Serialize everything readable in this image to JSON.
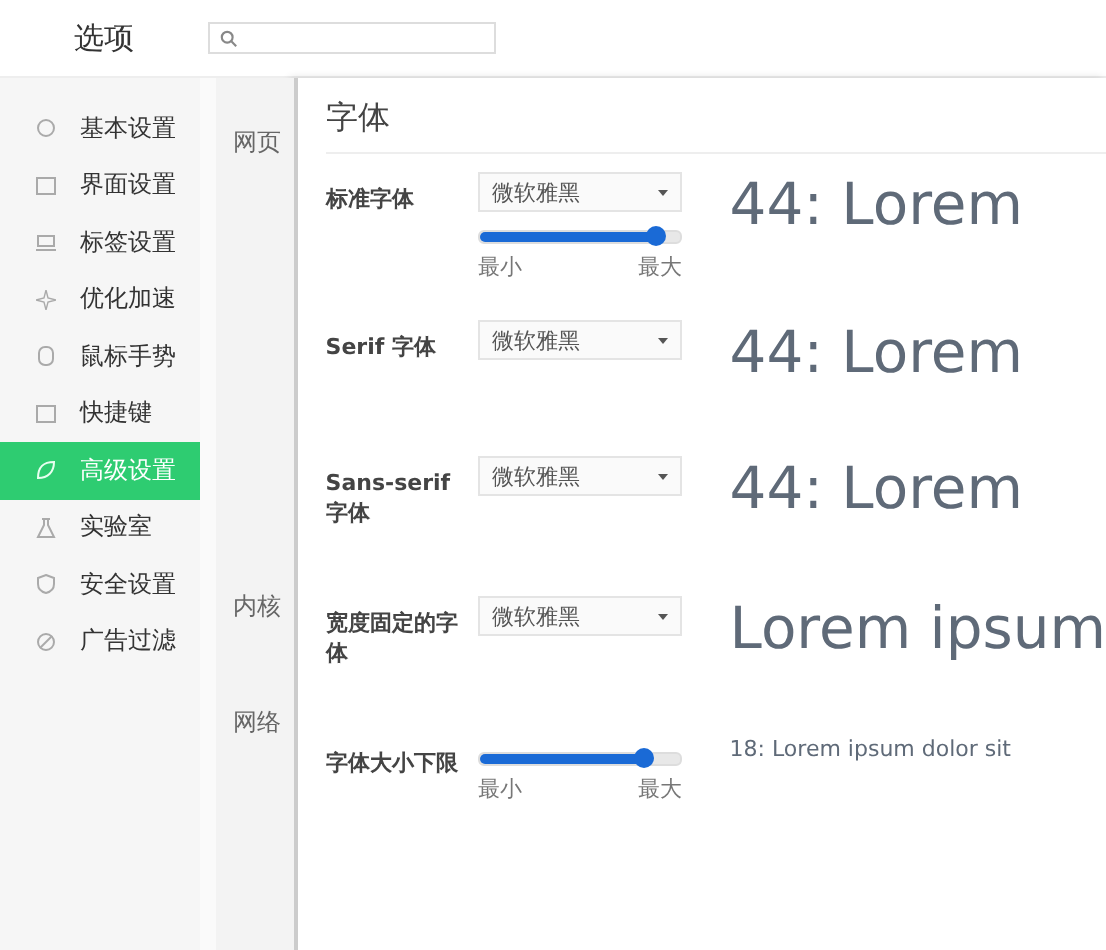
{
  "header": {
    "title": "选项"
  },
  "sidebar": {
    "items": [
      {
        "label": "基本设置",
        "selected": false
      },
      {
        "label": "界面设置",
        "selected": false
      },
      {
        "label": "标签设置",
        "selected": false
      },
      {
        "label": "优化加速",
        "selected": false
      },
      {
        "label": "鼠标手势",
        "selected": false
      },
      {
        "label": "快捷键",
        "selected": false
      },
      {
        "label": "高级设置",
        "selected": true
      },
      {
        "label": "实验室",
        "selected": false
      },
      {
        "label": "安全设置",
        "selected": false
      },
      {
        "label": "广告过滤",
        "selected": false
      }
    ]
  },
  "background_sections": [
    "网页",
    "内核",
    "网络"
  ],
  "dialog": {
    "title": "字体",
    "rows": [
      {
        "label": "标准字体",
        "select": "微软雅黑",
        "slider": {
          "level": 0.88,
          "min_label": "最小",
          "max_label": "最大"
        },
        "sample": {
          "kind": "large",
          "text": "44: Lorem"
        }
      },
      {
        "label": "Serif 字体",
        "select": "微软雅黑",
        "sample": {
          "kind": "large",
          "text": "44: Lorem"
        }
      },
      {
        "label": "Sans-serif 字体",
        "select": "微软雅黑",
        "sample": {
          "kind": "large",
          "text": "44: Lorem"
        }
      },
      {
        "label": "宽度固定的字体",
        "select": "微软雅黑",
        "sample": {
          "kind": "large",
          "text": "Lorem ipsum"
        }
      },
      {
        "label": "字体大小下限",
        "slider": {
          "level": 0.82,
          "min_label": "最小",
          "max_label": "最大"
        },
        "sample": {
          "kind": "small",
          "text": "18: Lorem ipsum dolor sit"
        }
      }
    ]
  }
}
